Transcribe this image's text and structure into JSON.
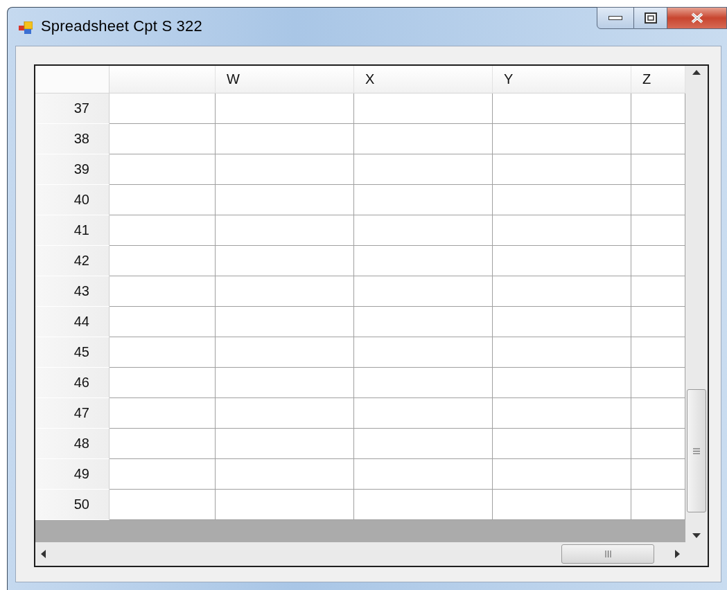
{
  "window": {
    "title": "Spreadsheet Cpt S 322"
  },
  "grid": {
    "columns": [
      {
        "label": "W"
      },
      {
        "label": "X"
      },
      {
        "label": "Y"
      },
      {
        "label": "Z"
      }
    ],
    "rows": [
      "37",
      "38",
      "39",
      "40",
      "41",
      "42",
      "43",
      "44",
      "45",
      "46",
      "47",
      "48",
      "49",
      "50"
    ]
  }
}
